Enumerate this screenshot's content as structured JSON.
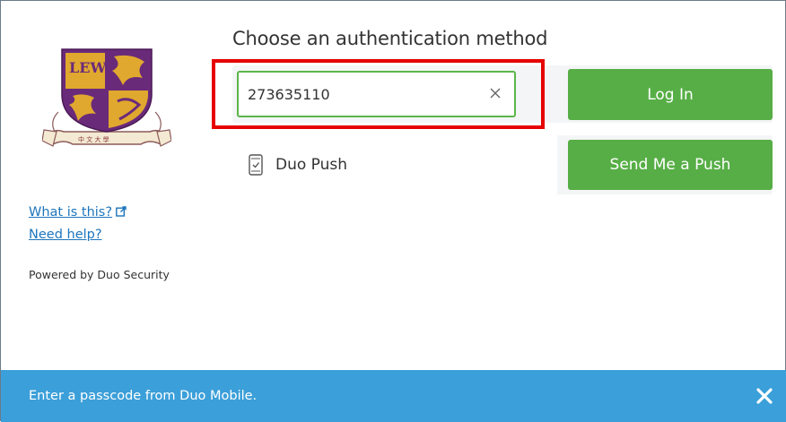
{
  "heading": "Choose an authentication method",
  "passcode": {
    "value": "273635110",
    "button_label": "Log In"
  },
  "push": {
    "label": "Duo Push",
    "button_label": "Send Me a Push"
  },
  "sidebar": {
    "what_is_this": "What is this?",
    "need_help": "Need help?",
    "powered_by": "Powered by Duo Security"
  },
  "footer": {
    "message": "Enter a passcode from Duo Mobile."
  },
  "colors": {
    "accent_green": "#57ae46",
    "input_border_green": "#5cb54a",
    "link_blue": "#1d75bc",
    "footer_blue": "#3b9fd9",
    "highlight_red": "#e60000",
    "logo_purple": "#6a2a7a",
    "logo_gold": "#e0a82e"
  },
  "icons": {
    "logo": "university-crest-logo",
    "external_link": "external-link-icon",
    "clear": "clear-x-icon",
    "phone": "mobile-phone-icon",
    "close": "close-icon"
  }
}
